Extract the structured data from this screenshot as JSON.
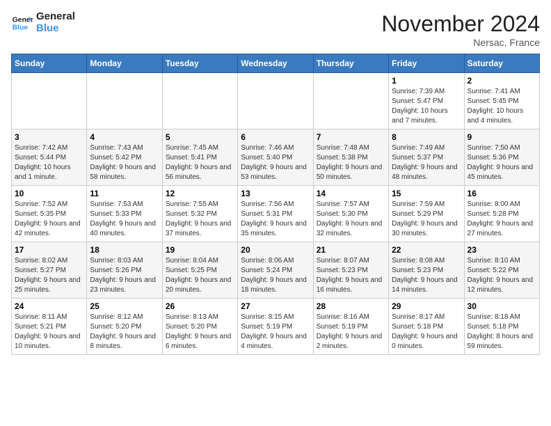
{
  "logo": {
    "line1": "General",
    "line2": "Blue"
  },
  "title": "November 2024",
  "location": "Nersac, France",
  "weekdays": [
    "Sunday",
    "Monday",
    "Tuesday",
    "Wednesday",
    "Thursday",
    "Friday",
    "Saturday"
  ],
  "weeks": [
    [
      {
        "day": "",
        "info": ""
      },
      {
        "day": "",
        "info": ""
      },
      {
        "day": "",
        "info": ""
      },
      {
        "day": "",
        "info": ""
      },
      {
        "day": "",
        "info": ""
      },
      {
        "day": "1",
        "info": "Sunrise: 7:39 AM\nSunset: 5:47 PM\nDaylight: 10 hours and 7 minutes."
      },
      {
        "day": "2",
        "info": "Sunrise: 7:41 AM\nSunset: 5:45 PM\nDaylight: 10 hours and 4 minutes."
      }
    ],
    [
      {
        "day": "3",
        "info": "Sunrise: 7:42 AM\nSunset: 5:44 PM\nDaylight: 10 hours and 1 minute."
      },
      {
        "day": "4",
        "info": "Sunrise: 7:43 AM\nSunset: 5:42 PM\nDaylight: 9 hours and 58 minutes."
      },
      {
        "day": "5",
        "info": "Sunrise: 7:45 AM\nSunset: 5:41 PM\nDaylight: 9 hours and 56 minutes."
      },
      {
        "day": "6",
        "info": "Sunrise: 7:46 AM\nSunset: 5:40 PM\nDaylight: 9 hours and 53 minutes."
      },
      {
        "day": "7",
        "info": "Sunrise: 7:48 AM\nSunset: 5:38 PM\nDaylight: 9 hours and 50 minutes."
      },
      {
        "day": "8",
        "info": "Sunrise: 7:49 AM\nSunset: 5:37 PM\nDaylight: 9 hours and 48 minutes."
      },
      {
        "day": "9",
        "info": "Sunrise: 7:50 AM\nSunset: 5:36 PM\nDaylight: 9 hours and 45 minutes."
      }
    ],
    [
      {
        "day": "10",
        "info": "Sunrise: 7:52 AM\nSunset: 5:35 PM\nDaylight: 9 hours and 42 minutes."
      },
      {
        "day": "11",
        "info": "Sunrise: 7:53 AM\nSunset: 5:33 PM\nDaylight: 9 hours and 40 minutes."
      },
      {
        "day": "12",
        "info": "Sunrise: 7:55 AM\nSunset: 5:32 PM\nDaylight: 9 hours and 37 minutes."
      },
      {
        "day": "13",
        "info": "Sunrise: 7:56 AM\nSunset: 5:31 PM\nDaylight: 9 hours and 35 minutes."
      },
      {
        "day": "14",
        "info": "Sunrise: 7:57 AM\nSunset: 5:30 PM\nDaylight: 9 hours and 32 minutes."
      },
      {
        "day": "15",
        "info": "Sunrise: 7:59 AM\nSunset: 5:29 PM\nDaylight: 9 hours and 30 minutes."
      },
      {
        "day": "16",
        "info": "Sunrise: 8:00 AM\nSunset: 5:28 PM\nDaylight: 9 hours and 27 minutes."
      }
    ],
    [
      {
        "day": "17",
        "info": "Sunrise: 8:02 AM\nSunset: 5:27 PM\nDaylight: 9 hours and 25 minutes."
      },
      {
        "day": "18",
        "info": "Sunrise: 8:03 AM\nSunset: 5:26 PM\nDaylight: 9 hours and 23 minutes."
      },
      {
        "day": "19",
        "info": "Sunrise: 8:04 AM\nSunset: 5:25 PM\nDaylight: 9 hours and 20 minutes."
      },
      {
        "day": "20",
        "info": "Sunrise: 8:06 AM\nSunset: 5:24 PM\nDaylight: 9 hours and 18 minutes."
      },
      {
        "day": "21",
        "info": "Sunrise: 8:07 AM\nSunset: 5:23 PM\nDaylight: 9 hours and 16 minutes."
      },
      {
        "day": "22",
        "info": "Sunrise: 8:08 AM\nSunset: 5:23 PM\nDaylight: 9 hours and 14 minutes."
      },
      {
        "day": "23",
        "info": "Sunrise: 8:10 AM\nSunset: 5:22 PM\nDaylight: 9 hours and 12 minutes."
      }
    ],
    [
      {
        "day": "24",
        "info": "Sunrise: 8:11 AM\nSunset: 5:21 PM\nDaylight: 9 hours and 10 minutes."
      },
      {
        "day": "25",
        "info": "Sunrise: 8:12 AM\nSunset: 5:20 PM\nDaylight: 9 hours and 8 minutes."
      },
      {
        "day": "26",
        "info": "Sunrise: 8:13 AM\nSunset: 5:20 PM\nDaylight: 9 hours and 6 minutes."
      },
      {
        "day": "27",
        "info": "Sunrise: 8:15 AM\nSunset: 5:19 PM\nDaylight: 9 hours and 4 minutes."
      },
      {
        "day": "28",
        "info": "Sunrise: 8:16 AM\nSunset: 5:19 PM\nDaylight: 9 hours and 2 minutes."
      },
      {
        "day": "29",
        "info": "Sunrise: 8:17 AM\nSunset: 5:18 PM\nDaylight: 9 hours and 0 minutes."
      },
      {
        "day": "30",
        "info": "Sunrise: 8:18 AM\nSunset: 5:18 PM\nDaylight: 8 hours and 59 minutes."
      }
    ]
  ]
}
